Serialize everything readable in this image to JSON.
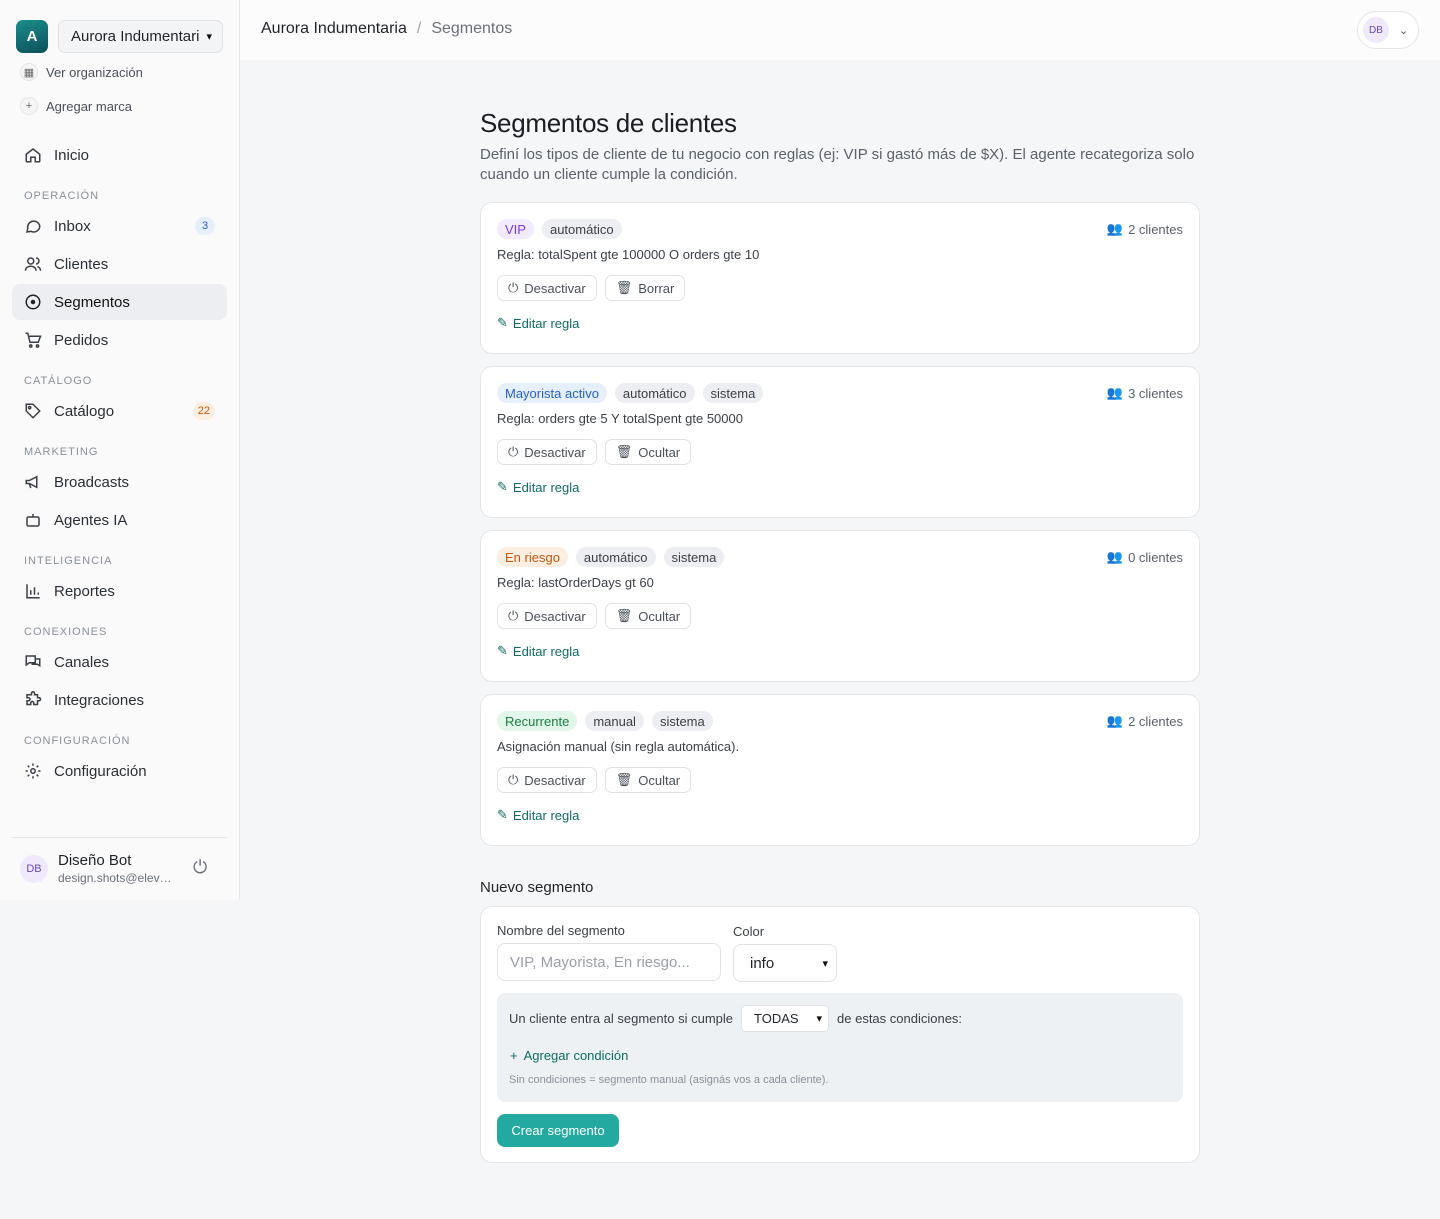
{
  "brand": {
    "logo_letter": "A",
    "name": "Aurora Indumentaria"
  },
  "org_links": {
    "view_org": "Ver organización",
    "add_brand": "Agregar marca"
  },
  "nav": {
    "home": "Inicio",
    "sections": {
      "operacion": "OPERACIÓN",
      "catalogo": "CATÁLOGO",
      "marketing": "MARKETING",
      "inteligencia": "INTELIGENCIA",
      "conexiones": "CONEXIONES",
      "configuracion": "CONFIGURACIÓN"
    },
    "inbox": "Inbox",
    "inbox_badge": "3",
    "clientes": "Clientes",
    "segmentos": "Segmentos",
    "pedidos": "Pedidos",
    "catalogo": "Catálogo",
    "catalogo_badge": "22",
    "broadcasts": "Broadcasts",
    "agentes": "Agentes IA",
    "reportes": "Reportes",
    "canales": "Canales",
    "integraciones": "Integraciones",
    "config": "Configuración"
  },
  "user": {
    "initials": "DB",
    "name": "Diseño Bot",
    "email": "design.shots@eleven.test"
  },
  "breadcrumb": {
    "root": "Aurora Indumentaria",
    "sep": "/",
    "current": "Segmentos"
  },
  "page": {
    "title": "Segmentos de clientes",
    "description": "Definí los tipos de cliente de tu negocio con reglas (ej: VIP si gastó más de $X). El agente recategoriza solo cuando un cliente cumple la condición."
  },
  "segments": [
    {
      "name": "VIP",
      "tags": [
        "automático"
      ],
      "count": "2 clientes",
      "rule": "Regla: totalSpent gte 100000 O orders gte 10",
      "deactivate": "Desactivar",
      "remove": "Borrar",
      "edit": "Editar regla"
    },
    {
      "name": "Mayorista activo",
      "tags": [
        "automático",
        "sistema"
      ],
      "count": "3 clientes",
      "rule": "Regla: orders gte 5 Y totalSpent gte 50000",
      "deactivate": "Desactivar",
      "remove": "Ocultar",
      "edit": "Editar regla"
    },
    {
      "name": "En riesgo",
      "tags": [
        "automático",
        "sistema"
      ],
      "count": "0 clientes",
      "rule": "Regla: lastOrderDays gt 60",
      "deactivate": "Desactivar",
      "remove": "Ocultar",
      "edit": "Editar regla"
    },
    {
      "name": "Recurrente",
      "tags": [
        "manual",
        "sistema"
      ],
      "count": "2 clientes",
      "rule": "Asignación manual (sin regla automática).",
      "deactivate": "Desactivar",
      "remove": "Ocultar",
      "edit": "Editar regla"
    }
  ],
  "new_segment": {
    "title": "Nuevo segmento",
    "name_label": "Nombre del segmento",
    "name_placeholder": "VIP, Mayorista, En riesgo...",
    "color_label": "Color",
    "color_value": "info",
    "cond_prefix": "Un cliente entra al segmento si cumple",
    "cond_mode": "TODAS",
    "cond_suffix": "de estas condiciones:",
    "add_condition": "Agregar condición",
    "hint": "Sin condiciones = segmento manual (asignás vos a cada cliente).",
    "create": "Crear segmento"
  },
  "colors": {
    "accent": "#23a99f",
    "link": "#0f6b63"
  }
}
